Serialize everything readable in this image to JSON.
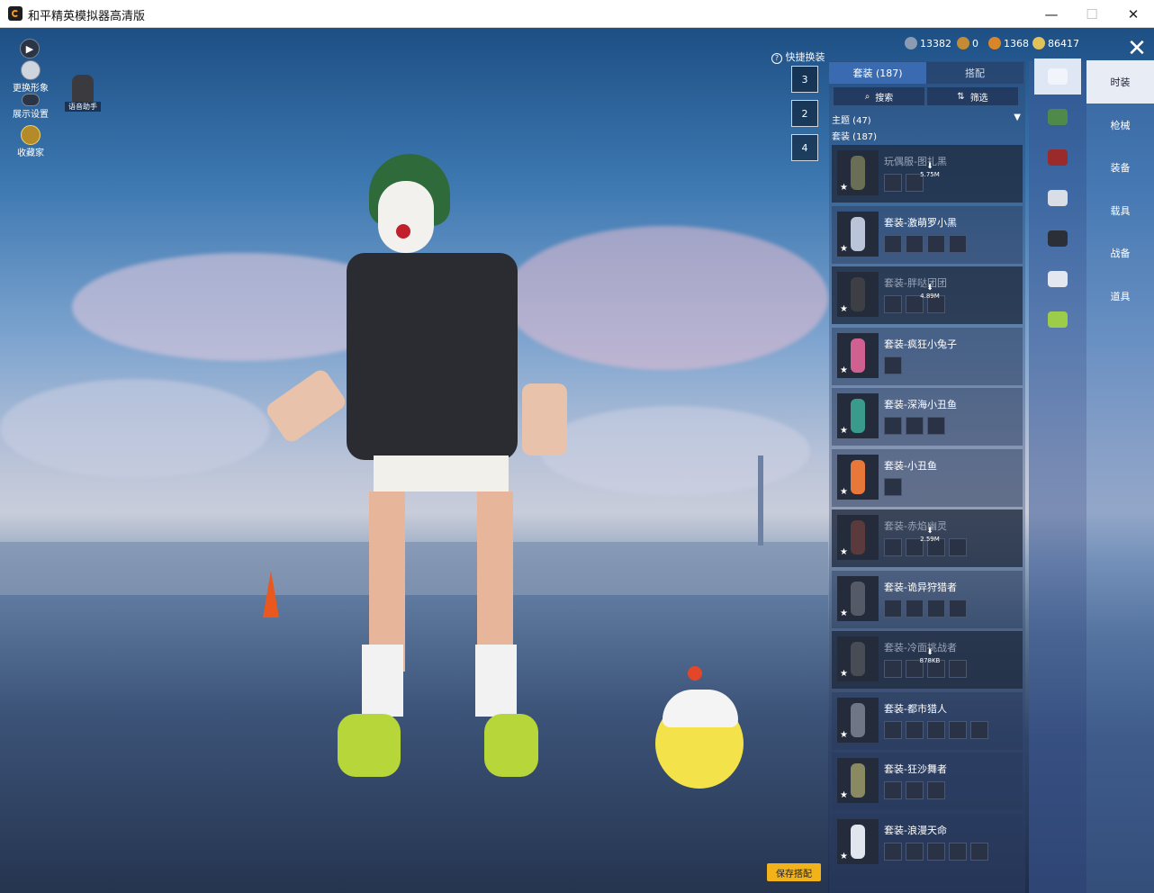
{
  "window": {
    "title": "和平精英模拟器高清版",
    "minimize": "—",
    "maximize": "☐",
    "close": "✕"
  },
  "left_toolbar": {
    "play_icon": "▶",
    "change_look": "更换形象",
    "display_settings": "展示设置",
    "collector": "收藏家",
    "voice_assistant": "语音助手"
  },
  "currencies": [
    {
      "value": "13382",
      "color": "#8b9bb3"
    },
    {
      "value": "0",
      "color": "#c48a34"
    },
    {
      "value": "1368",
      "color": "#d9862b"
    },
    {
      "value": "86417",
      "color": "#e0c15a"
    }
  ],
  "quick_change": {
    "label": "快捷换装",
    "slots": [
      "3",
      "2",
      "4"
    ]
  },
  "tabs": {
    "suits": "套装 (187)",
    "outfit": "搭配"
  },
  "search": {
    "search_label": "搜索",
    "filter_label": "筛选"
  },
  "categories": {
    "theme": "主题 (47)",
    "suits": "套装 (187)"
  },
  "items": [
    {
      "title": "玩偶服-图扎黑",
      "dim": true,
      "download": "5.75M",
      "subs": 2,
      "color": "#6a6e55"
    },
    {
      "title": "套装-激萌罗小黑",
      "dim": false,
      "download": "",
      "subs": 4,
      "color": "#b9c4d9"
    },
    {
      "title": "套装-胖哒团团",
      "dim": true,
      "download": "4.89M",
      "subs": 3,
      "color": "#3e3f44"
    },
    {
      "title": "套装-疯狂小兔子",
      "dim": false,
      "download": "",
      "subs": 1,
      "color": "#d06090"
    },
    {
      "title": "套装-深海小丑鱼",
      "dim": false,
      "download": "",
      "subs": 3,
      "color": "#3a9b8c"
    },
    {
      "title": "套装-小丑鱼",
      "dim": false,
      "download": "",
      "subs": 1,
      "color": "#e8773a"
    },
    {
      "title": "套装-赤焰幽灵",
      "dim": true,
      "download": "2.59M",
      "subs": 4,
      "color": "#5a3a3a"
    },
    {
      "title": "套装-诡异狩猎者",
      "dim": false,
      "download": "",
      "subs": 4,
      "color": "#555b66"
    },
    {
      "title": "套装-冷面挑战者",
      "dim": true,
      "download": "878KB",
      "subs": 4,
      "color": "#484c55"
    },
    {
      "title": "套装-都市猎人",
      "dim": false,
      "download": "",
      "subs": 5,
      "color": "#6f7786"
    },
    {
      "title": "套装-狂沙舞者",
      "dim": false,
      "download": "",
      "subs": 3,
      "color": "#8a8a62"
    },
    {
      "title": "套装-浪漫天命",
      "dim": false,
      "download": "",
      "subs": 5,
      "color": "#e1e5ee"
    }
  ],
  "side_categories": [
    "时装",
    "枪械",
    "装备",
    "载具",
    "战备",
    "道具"
  ],
  "icon_column": [
    {
      "name": "outfit-hanger-icon",
      "color": "#f1f4fa"
    },
    {
      "name": "helmet-icon",
      "color": "#4f8a4a"
    },
    {
      "name": "mask-icon",
      "color": "#9b2a2a"
    },
    {
      "name": "face-icon",
      "color": "#d8dde6"
    },
    {
      "name": "armor-icon",
      "color": "#2a2f38"
    },
    {
      "name": "figure-icon",
      "color": "#e3e8f0"
    },
    {
      "name": "pet-icon",
      "color": "#9ccd4a"
    }
  ],
  "close_label": "✕",
  "save_button": "保存搭配"
}
